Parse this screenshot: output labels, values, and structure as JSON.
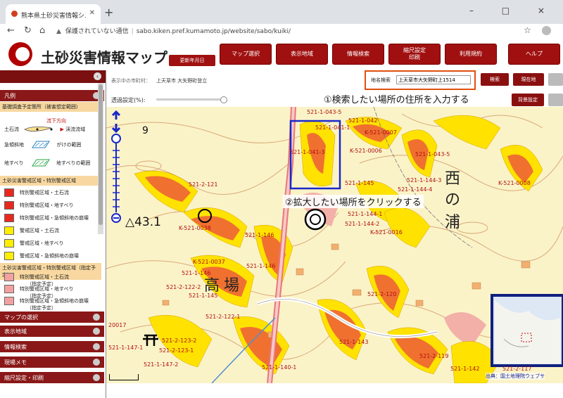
{
  "browser": {
    "tab_title": "熊本県土砂災害情報システム　警",
    "new_tab": "+",
    "window_controls": "– □ ×",
    "security_warning": "保護されていない通信",
    "url": "sabo.kiken.pref.kumamoto.jp/website/sabo/kuiki/"
  },
  "header": {
    "title": "土砂災害情報マップ",
    "updated_label": "更新年月日",
    "buttons": [
      {
        "label": "マップ選択"
      },
      {
        "label": "表示地域"
      },
      {
        "label": "情報検索"
      },
      {
        "label": "縮尺設定\n印刷"
      },
      {
        "label": "利用規約"
      },
      {
        "label": "ヘルプ"
      }
    ]
  },
  "toolbar": {
    "city_label": "表示中の市町村：",
    "city_value": "上天草市 大矢野町登立",
    "place_search_label": "地名検索",
    "place_search_value": "上天草市大矢野町上1514",
    "search_button": "検索",
    "current_location_button": "現在地",
    "opacity_label": "透過設定(%):",
    "background_button": "背景設定"
  },
  "annotations": {
    "step1": "①検索したい場所の住所を入力する",
    "step2": "②拡大したい場所をクリックする"
  },
  "sidebar": {
    "legend_header": "凡例",
    "survey_title": "基礎調査予定箇所（被害想定範囲）",
    "flow_direction": "流下方向",
    "debris_flow": "土石流",
    "stream_area": "渓流流域",
    "steep_slope": "急傾斜地",
    "cliff_range": "がけの範囲",
    "landslide": "地すべり",
    "landslide_range": "地すべりの範囲",
    "zone_title": "土砂災害警戒区域・特別警戒区域",
    "zones": [
      {
        "label": "特別警戒区域・土石流",
        "color": "#e8281e"
      },
      {
        "label": "特別警戒区域・地すべり",
        "color": "#e8281e"
      },
      {
        "label": "特別警戒区域・急傾斜地の崩壊",
        "color": "#e8281e"
      },
      {
        "label": "警戒区域・土石流",
        "color": "#ffee00"
      },
      {
        "label": "警戒区域・地すべり",
        "color": "#ffee00"
      },
      {
        "label": "警戒区域・急傾斜地の崩壊",
        "color": "#ffee00"
      }
    ],
    "planned_title": "土砂災害警戒区域・特別警戒区域（指定予定）",
    "planned": [
      {
        "label": "特別警戒区域・土石流",
        "sub": "（指定予定）",
        "color": "#f4a0a0"
      },
      {
        "label": "特別警戒区域・地すべり",
        "sub": "（指定予定）",
        "color": "#f4a0a0"
      },
      {
        "label": "特別警戒区域・急傾斜地の崩壊",
        "sub": "（指定予定）",
        "color": "#f4a0a0"
      }
    ],
    "sections": [
      {
        "label": "マップの選択"
      },
      {
        "label": "表示地域"
      },
      {
        "label": "情報検索"
      },
      {
        "label": "現場メモ"
      },
      {
        "label": "縮尺設定・印刷"
      }
    ]
  },
  "map": {
    "labels": [
      "521-1-043-5",
      "521-1-042",
      "521-1-041-1",
      "K-521-0007",
      "521-1-041-3",
      "K-521-0006",
      "521-1-043-5",
      "K-521-0008",
      "521-1-144-3",
      "521-1-144-4",
      "521-1-145",
      "521-2-121",
      "521-1-144-1",
      "521-1-144-2",
      "K-521-0016",
      "K-521-0038",
      "521-1-146",
      "K-521-0037",
      "521-1-146",
      "521-1-146",
      "521-2-122-2",
      "521-1-145",
      "521-2-120",
      "521-2-122-1",
      "521-1-143",
      "521-2-123-2",
      "521-2-123-1",
      "521-2-119",
      "521-1-140-1",
      "521-1-142",
      "521-1-147-2",
      "521-2-117",
      "521-1-147-1",
      "20017"
    ],
    "elevation": "△43.1",
    "place_names": [
      "西",
      "の",
      "浦",
      "場",
      "高"
    ],
    "nine_marker": "9",
    "attribution": "出典：国土地理院ウェブサ"
  },
  "colors": {
    "brand": "#a01010",
    "callout_border": "#e05010",
    "selection_box": "#1a28c8"
  }
}
